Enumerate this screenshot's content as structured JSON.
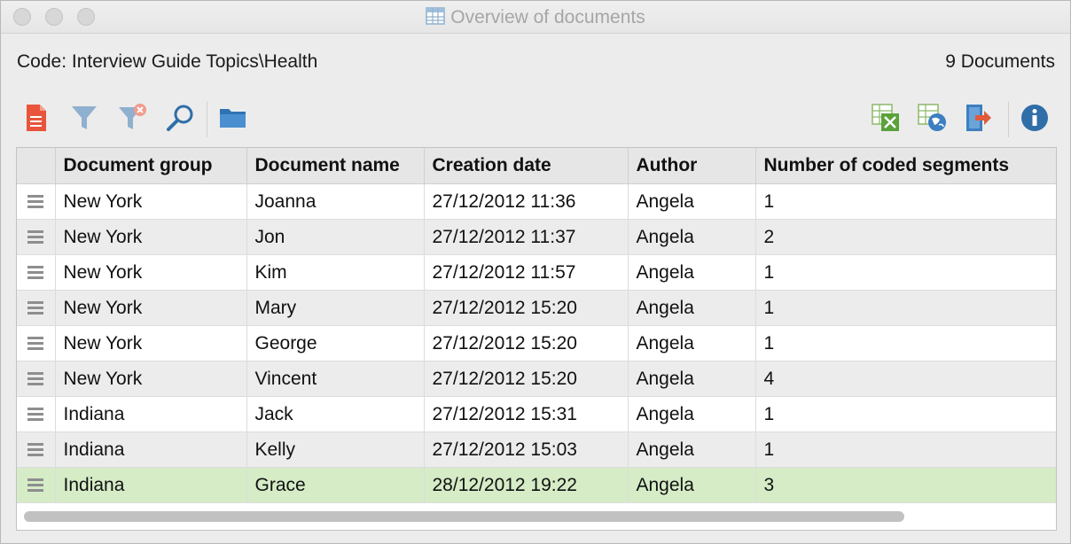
{
  "window": {
    "title": "Overview of documents"
  },
  "info": {
    "code_label": "Code: Interview Guide Topics\\Health",
    "doc_count": "9 Documents"
  },
  "toolbar": {
    "left": [
      {
        "name": "document-icon",
        "color": "#e8543c"
      },
      {
        "name": "filter-icon",
        "color": "#7fa3c4"
      },
      {
        "name": "clear-filter-icon",
        "color": "#7fa3c4"
      },
      {
        "name": "search-icon",
        "color": "#2f6ea8"
      },
      {
        "name": "folder-icon",
        "color": "#2f73b4"
      }
    ],
    "right": [
      {
        "name": "excel-export-icon",
        "color": "#5aa23a"
      },
      {
        "name": "web-export-icon",
        "color": "#3c7fc0"
      },
      {
        "name": "export-icon",
        "color": "#e05a3a"
      },
      {
        "name": "info-icon",
        "color": "#2f6ea8"
      }
    ]
  },
  "table": {
    "columns": [
      "",
      "Document group",
      "Document name",
      "Creation date",
      "Author",
      "Number of coded segments"
    ],
    "rows": [
      {
        "group": "New York",
        "name": "Joanna",
        "date": "27/12/2012 11:36",
        "author": "Angela",
        "segments": "1"
      },
      {
        "group": "New York",
        "name": "Jon",
        "date": "27/12/2012 11:37",
        "author": "Angela",
        "segments": "2"
      },
      {
        "group": "New York",
        "name": "Kim",
        "date": "27/12/2012 11:57",
        "author": "Angela",
        "segments": "1"
      },
      {
        "group": "New York",
        "name": "Mary",
        "date": "27/12/2012 15:20",
        "author": "Angela",
        "segments": "1"
      },
      {
        "group": "New York",
        "name": "George",
        "date": "27/12/2012 15:20",
        "author": "Angela",
        "segments": "1"
      },
      {
        "group": "New York",
        "name": "Vincent",
        "date": "27/12/2012 15:20",
        "author": "Angela",
        "segments": "4"
      },
      {
        "group": "Indiana",
        "name": "Jack",
        "date": "27/12/2012 15:31",
        "author": "Angela",
        "segments": "1"
      },
      {
        "group": "Indiana",
        "name": "Kelly",
        "date": "27/12/2012 15:03",
        "author": "Angela",
        "segments": "1"
      },
      {
        "group": "Indiana",
        "name": "Grace",
        "date": "28/12/2012 19:22",
        "author": "Angela",
        "segments": "3"
      }
    ],
    "selected_row": 8,
    "selected_color": "#d5ecc6"
  }
}
